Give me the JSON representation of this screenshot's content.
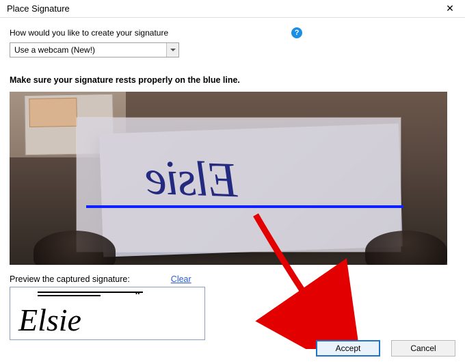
{
  "window": {
    "title": "Place Signature",
    "close_glyph": "✕"
  },
  "prompt": "How would you like to create your signature",
  "help_glyph": "?",
  "method_select": {
    "value": "Use a webcam (New!)"
  },
  "instruction": "Make sure your signature rests properly on the blue line.",
  "webcam_signature_text": "Elsie",
  "preview": {
    "label": "Preview the captured signature:",
    "clear": "Clear",
    "signature_text": "Elsie"
  },
  "buttons": {
    "accept": "Accept",
    "cancel": "Cancel"
  }
}
